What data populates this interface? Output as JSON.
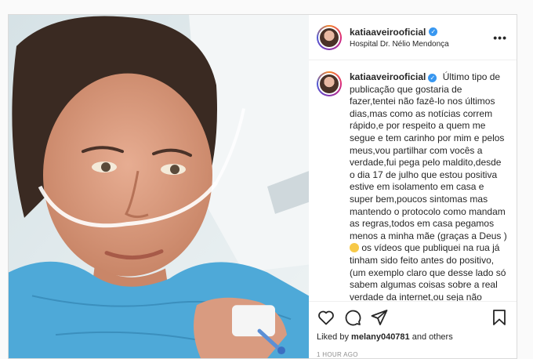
{
  "post": {
    "username": "katiaaveirooficial",
    "location": "Hospital Dr. Nélio Mendonça",
    "more_label": "•••",
    "caption_parts": {
      "before_emoji": "Último tipo de publicação que gostaria de fazer,tentei não fazê-lo nos últimos dias,mas como as notícias correm rápido,e por respeito a quem me segue e tem carinho por mim e pelos meus,vou partilhar com vocês a verdade,fui pega pelo maldito,desde o dia 17 de julho que estou positiva estive em isolamento em casa e super bem,poucos sintomas mas mantendo o protocolo como mandam as regras,todos em casa pegamos menos a minha mãe (graças a Deus )",
      "after_emoji": "os vídeos que publiquei na rua já tinham sido feito antes do positivo,(um exemplo claro que desse lado só sabem algumas coisas sobre a real verdade da internet,ou seja não acreditem em tudo) infelizmente desde"
    },
    "liked_by_prefix": "Liked by",
    "liked_by_user": "melany040781",
    "liked_by_suffix": "and others",
    "timestamp": "1 HOUR AGO"
  },
  "icons": {
    "like": "heart-icon",
    "comment": "comment-icon",
    "share": "send-icon",
    "save": "bookmark-icon",
    "verified": "verified-badge-icon"
  },
  "colors": {
    "verified_blue": "#3897f0",
    "border": "#dbdbdb",
    "muted": "#8e8e8e",
    "text": "#262626"
  }
}
